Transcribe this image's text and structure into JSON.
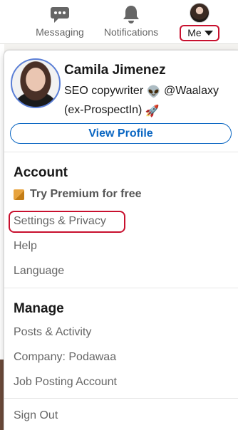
{
  "nav": {
    "messaging_label": "Messaging",
    "notifications_label": "Notifications",
    "me_label": "Me"
  },
  "profile": {
    "name": "Camila Jimenez",
    "headline_part1": "SEO copywriter ",
    "alien_emoji": "👽",
    "headline_part2": " @Waalaxy",
    "headline_part3": "(ex-ProspectIn) ",
    "rocket_emoji": "🚀",
    "view_profile_label": "View Profile"
  },
  "account": {
    "heading": "Account",
    "premium_label": "Try Premium for free",
    "items": [
      "Settings & Privacy",
      "Help",
      "Language"
    ]
  },
  "manage": {
    "heading": "Manage",
    "items": [
      "Posts & Activity",
      "Company: Podawaa",
      "Job Posting Account"
    ]
  },
  "sign_out_label": "Sign Out",
  "colors": {
    "accent_blue": "#0a66c2",
    "highlight_red": "#c8102e",
    "premium_gold": "#e7a33e"
  },
  "icons": [
    "messaging-icon",
    "notifications-bell-icon",
    "premium-icon"
  ]
}
